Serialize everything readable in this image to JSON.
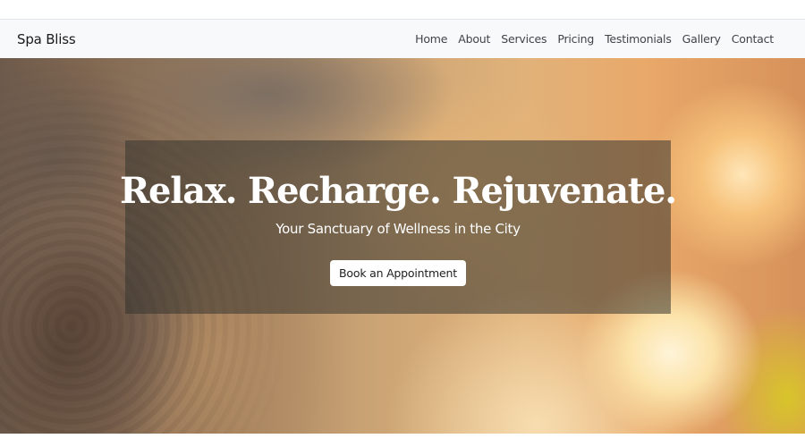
{
  "navbar": {
    "brand": "Spa Bliss",
    "links": [
      {
        "label": "Home"
      },
      {
        "label": "About"
      },
      {
        "label": "Services"
      },
      {
        "label": "Pricing"
      },
      {
        "label": "Testimonials"
      },
      {
        "label": "Gallery"
      },
      {
        "label": "Contact"
      }
    ]
  },
  "hero": {
    "title": "Relax. Recharge. Rejuvenate.",
    "subtitle": "Your Sanctuary of Wellness in the City",
    "cta_label": "Book an Appointment"
  },
  "colors": {
    "navbar_bg": "#f8f9fa",
    "overlay": "rgba(55, 52, 48, 0.55)",
    "button_bg": "#ffffff"
  }
}
